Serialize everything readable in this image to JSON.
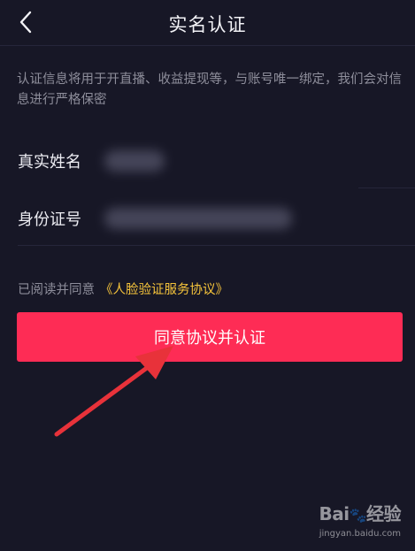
{
  "header": {
    "title": "实名认证",
    "back_icon": "chevron-left-icon"
  },
  "notice": {
    "text": "认证信息将用于开直播、收益提现等，与账号唯一绑定，我们会对信息进行严格保密"
  },
  "form": {
    "name_label": "真实姓名",
    "id_label": "身份证号"
  },
  "agreement": {
    "prefix": "已阅读并同意",
    "link": "《人脸验证服务协议》"
  },
  "submit": {
    "label": "同意协议并认证"
  },
  "watermark": {
    "brand": "Bai",
    "brand_suffix": "经验",
    "url": "jingyan.baidu.com"
  },
  "colors": {
    "background": "#171726",
    "primary_button": "#fe2c55",
    "link": "#f5c33b",
    "arrow": "#e8323a"
  }
}
